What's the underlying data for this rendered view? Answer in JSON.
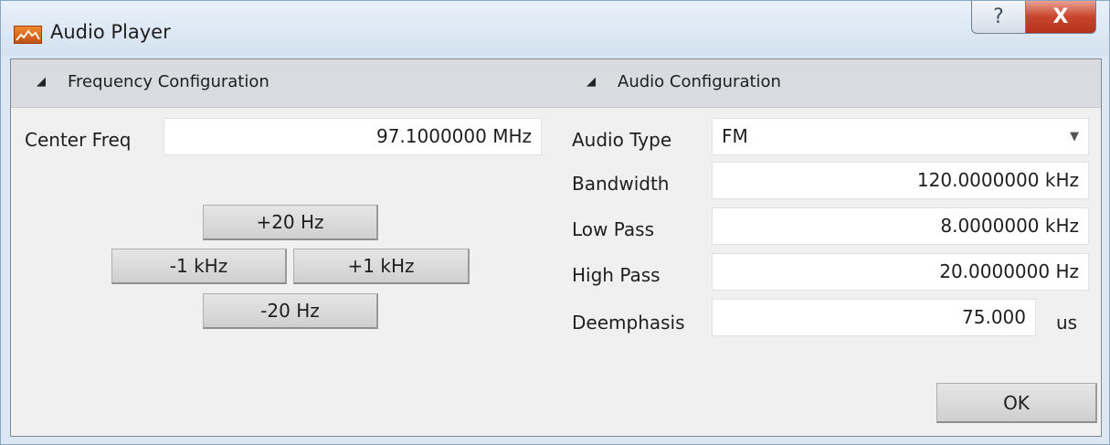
{
  "window": {
    "title": "Audio Player",
    "help_label": "?",
    "close_label": "X"
  },
  "frequency": {
    "header": "Frequency Configuration",
    "center_freq_label": "Center Freq",
    "center_freq_value": "97.1000000 MHz",
    "buttons": {
      "plus20hz": "+20 Hz",
      "minus1khz": "-1 kHz",
      "plus1khz": "+1 kHz",
      "minus20hz": "-20 Hz"
    }
  },
  "audio": {
    "header": "Audio Configuration",
    "audio_type_label": "Audio Type",
    "audio_type_value": "FM",
    "bandwidth_label": "Bandwidth",
    "bandwidth_value": "120.0000000 kHz",
    "low_pass_label": "Low Pass",
    "low_pass_value": "8.0000000 kHz",
    "high_pass_label": "High Pass",
    "high_pass_value": "20.0000000 Hz",
    "deemphasis_label": "Deemphasis",
    "deemphasis_value": "75.000",
    "deemphasis_unit": "us"
  },
  "ok_label": "OK",
  "icons": {
    "section_toggle": "collapse-triangle-icon",
    "dropdown": "chevron-down-icon"
  }
}
